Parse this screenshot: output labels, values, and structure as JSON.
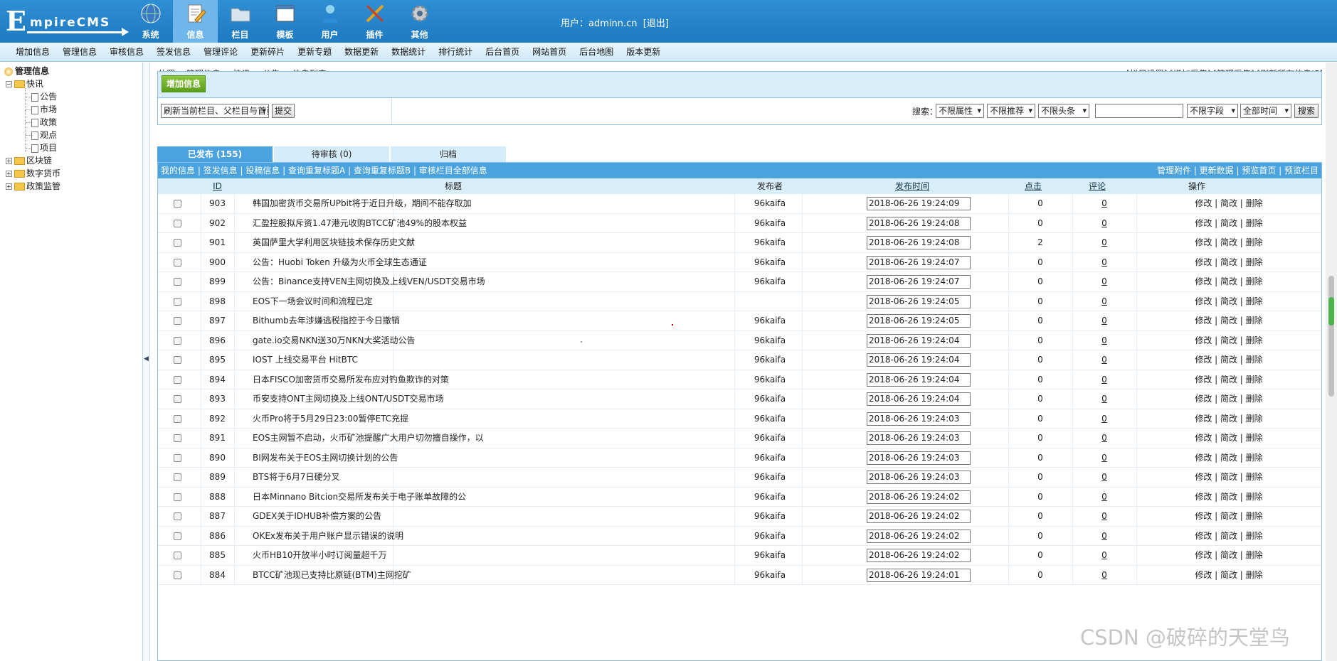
{
  "logo": {
    "big": "E",
    "rest": "mpireCMS"
  },
  "mainnav": [
    {
      "label": "系统",
      "icon": "globe-icon"
    },
    {
      "label": "信息",
      "icon": "edit-document-icon",
      "active": true
    },
    {
      "label": "栏目",
      "icon": "folder-icon"
    },
    {
      "label": "模板",
      "icon": "window-template-icon"
    },
    {
      "label": "用户",
      "icon": "user-icon"
    },
    {
      "label": "插件",
      "icon": "tools-icon"
    },
    {
      "label": "其他",
      "icon": "gear-icon"
    }
  ],
  "user": {
    "label": "用户：",
    "name": "adminn.cn",
    "logout": "[退出]"
  },
  "subnav": [
    "增加信息",
    "管理信息",
    "审核信息",
    "签发信息",
    "管理评论",
    "更新碎片",
    "更新专题",
    "数据更新",
    "数据统计",
    "排行统计",
    "后台首页",
    "网站首页",
    "后台地图",
    "版本更新"
  ],
  "sidebar": {
    "root": "管理信息",
    "nodes": [
      {
        "label": "快讯",
        "children": [
          "公告",
          "市场",
          "政策",
          "观点",
          "项目"
        ]
      },
      {
        "label": "区块链"
      },
      {
        "label": "数字货币"
      },
      {
        "label": "政策监管"
      }
    ]
  },
  "position": "位置：  管理信息 > 快讯 > 公告 > 信息列表",
  "toplinks": "[栏目设置] [增加采集] [管理采集] [刷新所有信息JS]",
  "addbtn": "增加信息",
  "refresh": {
    "selected": "刷新当前栏目、父栏目与首页",
    "submit": "提交"
  },
  "search": {
    "label": "搜索：",
    "attr": "不限属性",
    "recommend": "不限推荐",
    "headline": "不限头条",
    "field": "不限字段",
    "time": "全部时间",
    "button": "搜索"
  },
  "tabs": [
    "已发布 (155)",
    "待审核 (0)",
    "归档"
  ],
  "listbar": {
    "left": "我的信息 | 签发信息 | 投稿信息 | 查询重复标题A | 查询重复标题B | 审核栏目全部信息",
    "right": "管理附件 | 更新数据 | 预览首页 | 预览栏目"
  },
  "columns": {
    "id": "ID",
    "title": "标题",
    "author": "发布者",
    "time": "发布时间",
    "clicks": "点击",
    "comments": "评论",
    "actions": "操作"
  },
  "actions": "修改 | 简改 | 删除",
  "rows": [
    {
      "id": "903",
      "title": "韩国加密货币交易所UPbit将于近日升级，期间不能存取加",
      "author": "96kaifa",
      "time": "2018-06-26 19:24:09",
      "clicks": "0",
      "comments": "0"
    },
    {
      "id": "902",
      "title": "汇盈控股拟斥资1.47港元收购BTCC矿池49%的股本权益",
      "author": "96kaifa",
      "time": "2018-06-26 19:24:08",
      "clicks": "0",
      "comments": "0"
    },
    {
      "id": "901",
      "title": "英国萨里大学利用区块链技术保存历史文献",
      "author": "96kaifa",
      "time": "2018-06-26 19:24:08",
      "clicks": "2",
      "comments": "0"
    },
    {
      "id": "900",
      "title": "公告：Huobi Token 升级为火币全球生态通证",
      "author": "96kaifa",
      "time": "2018-06-26 19:24:07",
      "clicks": "0",
      "comments": "0"
    },
    {
      "id": "899",
      "title": "公告：Binance支持VEN主网切换及上线VEN/USDT交易市场",
      "author": "96kaifa",
      "time": "2018-06-26 19:24:07",
      "clicks": "0",
      "comments": "0"
    },
    {
      "id": "898",
      "title": "EOS下一场会议时间和流程已定",
      "author": "",
      "time": "2018-06-26 19:24:05",
      "clicks": "0",
      "comments": "0"
    },
    {
      "id": "897",
      "title": "Bithumb去年涉嫌逃税指控于今日撤销",
      "author": "96kaifa",
      "time": "2018-06-26 19:24:05",
      "clicks": "0",
      "comments": "0"
    },
    {
      "id": "896",
      "title": "gate.io交易NKN送30万NKN大奖活动公告",
      "author": "96kaifa",
      "time": "2018-06-26 19:24:04",
      "clicks": "0",
      "comments": "0"
    },
    {
      "id": "895",
      "title": "IOST 上线交易平台 HitBTC",
      "author": "96kaifa",
      "time": "2018-06-26 19:24:04",
      "clicks": "0",
      "comments": "0"
    },
    {
      "id": "894",
      "title": "日本FISCO加密货币交易所发布应对钓鱼欺诈的对策",
      "author": "96kaifa",
      "time": "2018-06-26 19:24:04",
      "clicks": "0",
      "comments": "0"
    },
    {
      "id": "893",
      "title": "币安支持ONT主网切换及上线ONT/USDT交易市场",
      "author": "96kaifa",
      "time": "2018-06-26 19:24:04",
      "clicks": "0",
      "comments": "0"
    },
    {
      "id": "892",
      "title": "火币Pro将于5月29日23:00暂停ETC充提",
      "author": "96kaifa",
      "time": "2018-06-26 19:24:03",
      "clicks": "0",
      "comments": "0"
    },
    {
      "id": "891",
      "title": "EOS主网暂不启动，火币矿池提醒广大用户切勿擅自操作，以",
      "author": "96kaifa",
      "time": "2018-06-26 19:24:03",
      "clicks": "0",
      "comments": "0"
    },
    {
      "id": "890",
      "title": "BI网发布关于EOS主网切换计划的公告",
      "author": "96kaifa",
      "time": "2018-06-26 19:24:03",
      "clicks": "0",
      "comments": "0"
    },
    {
      "id": "889",
      "title": "BTS将于6月7日硬分叉",
      "author": "96kaifa",
      "time": "2018-06-26 19:24:03",
      "clicks": "0",
      "comments": "0"
    },
    {
      "id": "888",
      "title": "日本Minnano Bitcion交易所发布关于电子账单故障的公",
      "author": "96kaifa",
      "time": "2018-06-26 19:24:02",
      "clicks": "0",
      "comments": "0"
    },
    {
      "id": "887",
      "title": "GDEX关于IDHUB补偿方案的公告",
      "author": "96kaifa",
      "time": "2018-06-26 19:24:02",
      "clicks": "0",
      "comments": "0"
    },
    {
      "id": "886",
      "title": "OKEx发布关于用户账户显示错误的说明",
      "author": "96kaifa",
      "time": "2018-06-26 19:24:02",
      "clicks": "0",
      "comments": "0"
    },
    {
      "id": "885",
      "title": "火币HB10开放半小时订阅量超千万",
      "author": "96kaifa",
      "time": "2018-06-26 19:24:02",
      "clicks": "0",
      "comments": "0"
    },
    {
      "id": "884",
      "title": "BTCC矿池现已支持比原链(BTM)主网挖矿",
      "author": "96kaifa",
      "time": "2018-06-26 19:24:01",
      "clicks": "0",
      "comments": "0"
    }
  ],
  "watermark": "CSDN @破碎的天堂鸟"
}
